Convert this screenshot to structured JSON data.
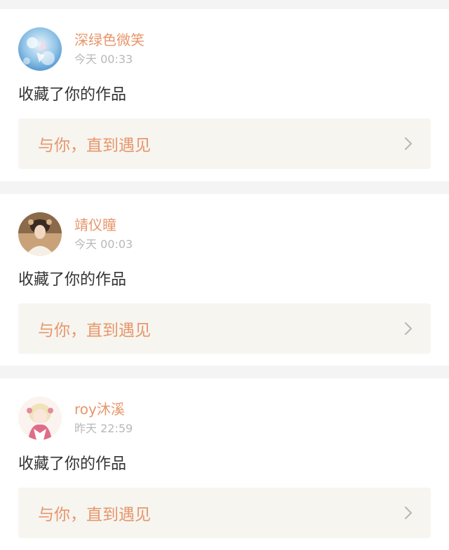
{
  "notifications": [
    {
      "username": "深绿色微笑",
      "time": "今天 00:33",
      "action": "收藏了你的作品",
      "work_title": "与你，直到遇见"
    },
    {
      "username": "靖仪瞳",
      "time": "今天 00:03",
      "action": "收藏了你的作品",
      "work_title": "与你，直到遇见"
    },
    {
      "username": "roy沐溪",
      "time": "昨天 22:59",
      "action": "收藏了你的作品",
      "work_title": "与你，直到遇见"
    }
  ],
  "colors": {
    "accent": "#e8966b",
    "time": "#b8b8b8",
    "text": "#333333",
    "link_bg": "#f6f5f0",
    "page_bg": "#f4f4f4"
  },
  "icons": {
    "chevron": "chevron-right-icon"
  }
}
